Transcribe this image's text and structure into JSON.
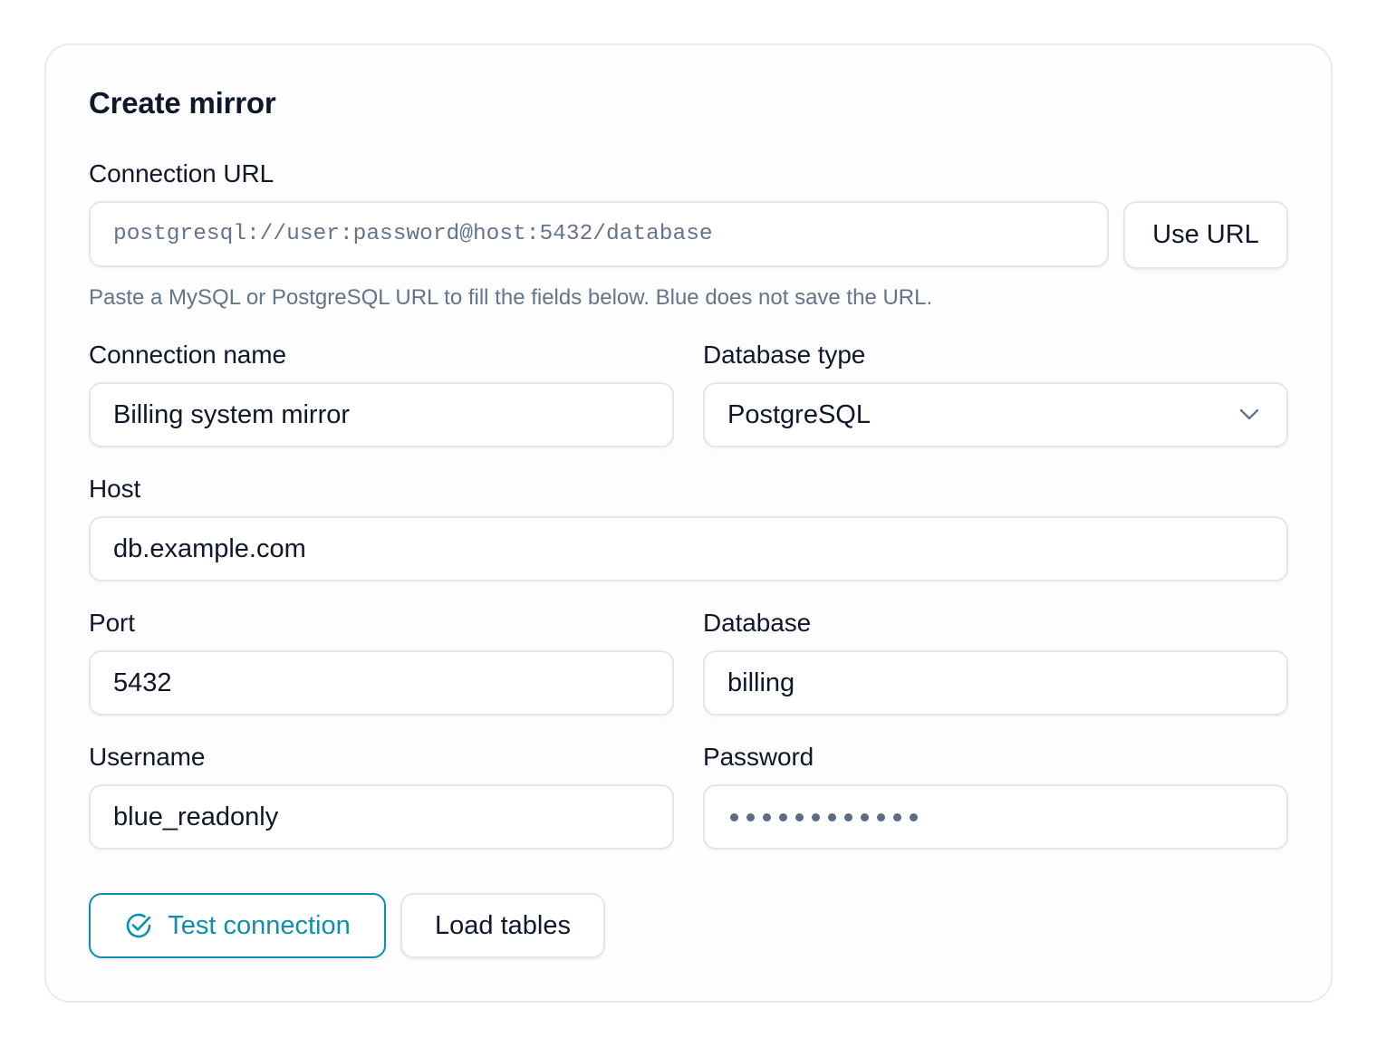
{
  "form": {
    "title": "Create mirror",
    "connection_url": {
      "label": "Connection URL",
      "placeholder": "postgresql://user:password@host:5432/database",
      "use_button": "Use URL",
      "help_text": "Paste a MySQL or PostgreSQL URL to fill the fields below. Blue does not save the URL."
    },
    "connection_name": {
      "label": "Connection name",
      "value": "Billing system mirror"
    },
    "database_type": {
      "label": "Database type",
      "value": "PostgreSQL"
    },
    "host": {
      "label": "Host",
      "value": "db.example.com"
    },
    "port": {
      "label": "Port",
      "value": "5432"
    },
    "database": {
      "label": "Database",
      "value": "billing"
    },
    "username": {
      "label": "Username",
      "value": "blue_readonly"
    },
    "password": {
      "label": "Password",
      "masked_length": 12
    },
    "actions": {
      "test_connection": "Test connection",
      "load_tables": "Load tables"
    }
  },
  "colors": {
    "accent": "#0891b2",
    "muted_text": "#64748b",
    "border": "#e2e6ec"
  },
  "icons": {
    "test_connection": "check-circle-icon",
    "database_type_select": "chevron-down-icon"
  }
}
